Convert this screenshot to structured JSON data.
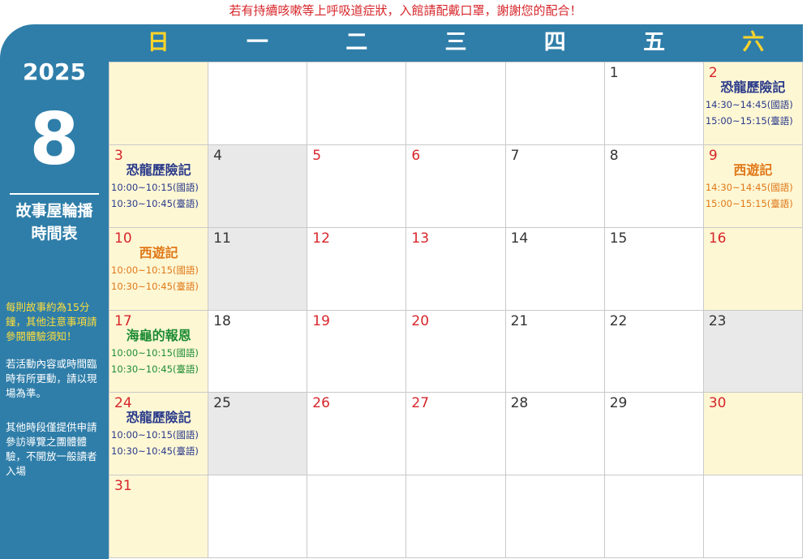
{
  "notice": "若有持續咳嗽等上呼吸道症狀，入館請配戴口罩，謝謝您的配合！",
  "sidebar": {
    "year": "2025",
    "month": "8",
    "title_line1": "故事屋輪播",
    "title_line2": "時間表",
    "note_yellow": "每則故事約為15分鐘，其他注意事項請參閱體驗須知！",
    "note_white1": "若活動內容或時間臨時有所更動，請以現場為準。",
    "note_white2": "其他時段僅提供申請參訪導覽之團體體驗，不開放一般讀者入場"
  },
  "weekdays": [
    "日",
    "一",
    "二",
    "三",
    "四",
    "五",
    "六"
  ],
  "colors": {
    "panel": "#2f7ea9",
    "weekend_bg": "#fdf7d4",
    "closed_bg": "#e9e9e9",
    "red": "#d7262b",
    "blue": "#2a3a8a",
    "orange": "#e07818",
    "green": "#1e8c34"
  },
  "weeks": [
    [
      {
        "day": "",
        "type": "weekend"
      },
      {
        "day": "",
        "type": "normal"
      },
      {
        "day": "",
        "type": "normal"
      },
      {
        "day": "",
        "type": "normal"
      },
      {
        "day": "",
        "type": "normal"
      },
      {
        "day": "1",
        "type": "normal"
      },
      {
        "day": "2",
        "type": "weekend",
        "red": true,
        "event": {
          "title": "恐龍歷險記",
          "times": [
            "14:30~14:45(國語)",
            "15:00~15:15(臺語)"
          ],
          "color": "blue"
        }
      }
    ],
    [
      {
        "day": "3",
        "type": "weekend",
        "red": true,
        "event": {
          "title": "恐龍歷險記",
          "times": [
            "10:00~10:15(國語)",
            "10:30~10:45(臺語)"
          ],
          "color": "blue"
        }
      },
      {
        "day": "4",
        "type": "closed"
      },
      {
        "day": "5",
        "type": "normal",
        "red": true
      },
      {
        "day": "6",
        "type": "normal",
        "red": true
      },
      {
        "day": "7",
        "type": "normal"
      },
      {
        "day": "8",
        "type": "normal"
      },
      {
        "day": "9",
        "type": "weekend",
        "red": true,
        "event": {
          "title": "西遊記",
          "times": [
            "14:30~14:45(國語)",
            "15:00~15:15(臺語)"
          ],
          "color": "orange"
        }
      }
    ],
    [
      {
        "day": "10",
        "type": "weekend",
        "red": true,
        "event": {
          "title": "西遊記",
          "times": [
            "10:00~10:15(國語)",
            "10:30~10:45(臺語)"
          ],
          "color": "orange"
        }
      },
      {
        "day": "11",
        "type": "closed"
      },
      {
        "day": "12",
        "type": "normal",
        "red": true
      },
      {
        "day": "13",
        "type": "normal",
        "red": true
      },
      {
        "day": "14",
        "type": "normal"
      },
      {
        "day": "15",
        "type": "normal"
      },
      {
        "day": "16",
        "type": "weekend",
        "red": true
      }
    ],
    [
      {
        "day": "17",
        "type": "weekend",
        "red": true,
        "event": {
          "title": "海龜的報恩",
          "times": [
            "10:00~10:15(國語)",
            "10:30~10:45(臺語)"
          ],
          "color": "green"
        }
      },
      {
        "day": "18",
        "type": "normal"
      },
      {
        "day": "19",
        "type": "normal",
        "red": true
      },
      {
        "day": "20",
        "type": "normal",
        "red": true
      },
      {
        "day": "21",
        "type": "normal"
      },
      {
        "day": "22",
        "type": "normal"
      },
      {
        "day": "23",
        "type": "closed"
      }
    ],
    [
      {
        "day": "24",
        "type": "weekend",
        "red": true,
        "event": {
          "title": "恐龍歷險記",
          "times": [
            "10:00~10:15(國語)",
            "10:30~10:45(臺語)"
          ],
          "color": "blue"
        }
      },
      {
        "day": "25",
        "type": "closed"
      },
      {
        "day": "26",
        "type": "normal",
        "red": true
      },
      {
        "day": "27",
        "type": "normal",
        "red": true
      },
      {
        "day": "28",
        "type": "normal"
      },
      {
        "day": "29",
        "type": "normal"
      },
      {
        "day": "30",
        "type": "weekend",
        "red": true
      }
    ],
    [
      {
        "day": "31",
        "type": "weekend",
        "red": true
      },
      {
        "day": "",
        "type": "normal"
      },
      {
        "day": "",
        "type": "normal"
      },
      {
        "day": "",
        "type": "normal"
      },
      {
        "day": "",
        "type": "normal"
      },
      {
        "day": "",
        "type": "normal"
      },
      {
        "day": "",
        "type": "normal"
      }
    ]
  ]
}
